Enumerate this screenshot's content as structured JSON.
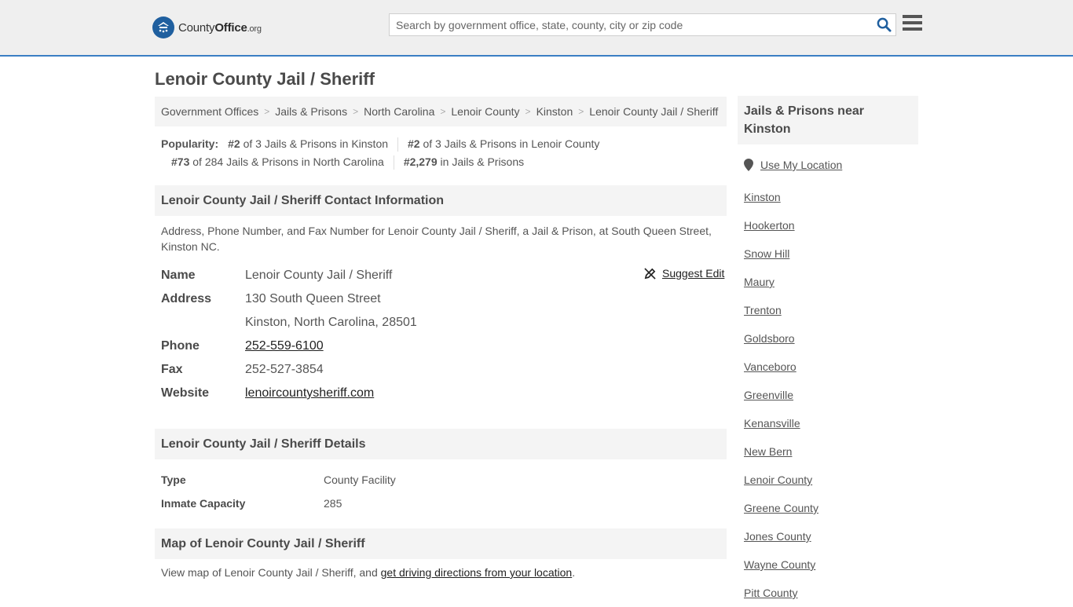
{
  "header": {
    "logo_county": "County",
    "logo_office": "Office",
    "logo_tld": ".org",
    "search_placeholder": "Search by government office, state, county, city or zip code"
  },
  "page_title": "Lenoir County Jail / Sheriff",
  "breadcrumb": [
    "Government Offices",
    "Jails & Prisons",
    "North Carolina",
    "Lenoir County",
    "Kinston",
    "Lenoir County Jail / Sheriff"
  ],
  "popularity": {
    "label": "Popularity:",
    "items": [
      {
        "rank": "#2",
        "text": "of 3 Jails & Prisons in Kinston"
      },
      {
        "rank": "#2",
        "text": "of 3 Jails & Prisons in Lenoir County"
      },
      {
        "rank": "#73",
        "text": "of 284 Jails & Prisons in North Carolina"
      },
      {
        "rank": "#2,279",
        "text": "in Jails & Prisons"
      }
    ]
  },
  "contact": {
    "heading": "Lenoir County Jail / Sheriff Contact Information",
    "description": "Address, Phone Number, and Fax Number for Lenoir County Jail / Sheriff, a Jail & Prison, at South Queen Street, Kinston NC.",
    "suggest_edit": "Suggest Edit",
    "labels": {
      "name": "Name",
      "address": "Address",
      "phone": "Phone",
      "fax": "Fax",
      "website": "Website"
    },
    "name": "Lenoir County Jail / Sheriff",
    "address_line1": "130 South Queen Street",
    "address_line2": "Kinston, North Carolina, 28501",
    "phone": "252-559-6100",
    "fax": "252-527-3854",
    "website": "lenoircountysheriff.com"
  },
  "details": {
    "heading": "Lenoir County Jail / Sheriff Details",
    "type_label": "Type",
    "type_value": "County Facility",
    "capacity_label": "Inmate Capacity",
    "capacity_value": "285"
  },
  "map": {
    "heading": "Map of Lenoir County Jail / Sheriff",
    "desc_prefix": "View map of Lenoir County Jail / Sheriff, and ",
    "desc_link": "get driving directions from your location",
    "desc_suffix": "."
  },
  "sidebar": {
    "heading": "Jails & Prisons near Kinston",
    "use_location": "Use My Location",
    "links": [
      "Kinston",
      "Hookerton",
      "Snow Hill",
      "Maury",
      "Trenton",
      "Goldsboro",
      "Vanceboro",
      "Greenville",
      "Kenansville",
      "New Bern",
      "Lenoir County",
      "Greene County",
      "Jones County",
      "Wayne County",
      "Pitt County"
    ]
  }
}
